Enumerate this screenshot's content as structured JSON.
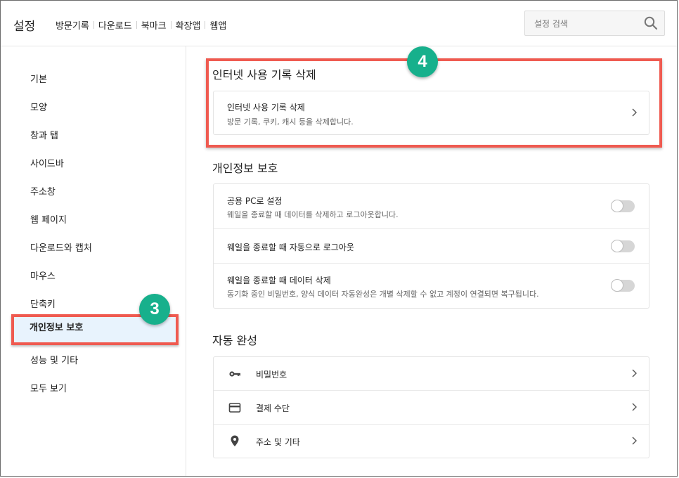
{
  "header": {
    "title": "설정",
    "nav": [
      "방문기록",
      "다운로드",
      "북마크",
      "확장앱",
      "웹앱"
    ],
    "search_placeholder": "설정 검색"
  },
  "sidebar": {
    "items": [
      {
        "label": "기본"
      },
      {
        "label": "모양"
      },
      {
        "label": "창과 탭"
      },
      {
        "label": "사이드바"
      },
      {
        "label": "주소창"
      },
      {
        "label": "웹 페이지"
      },
      {
        "label": "다운로드와 캡처"
      },
      {
        "label": "마우스"
      },
      {
        "label": "단축키"
      },
      {
        "label": "개인정보 보호",
        "active": true
      },
      {
        "label": "성능 및 기타"
      },
      {
        "label": "모두 보기"
      }
    ]
  },
  "annotations": {
    "sidebar_badge": "3",
    "content_badge": "4",
    "highlight_color": "#ef5a50",
    "badge_color": "#17b08c"
  },
  "sections": {
    "history": {
      "title": "인터넷 사용 기록 삭제",
      "item_title": "인터넷 사용 기록 삭제",
      "item_sub": "방문 기록, 쿠키, 캐시 등을 삭제합니다."
    },
    "privacy": {
      "title": "개인정보 보호",
      "rows": [
        {
          "title": "공용 PC로 설정",
          "sub": "웨일을 종료할 때 데이터를 삭제하고 로그아웃합니다.",
          "on": false
        },
        {
          "title": "웨일을 종료할 때 자동으로 로그아웃",
          "on": false
        },
        {
          "title": "웨일을 종료할 때 데이터 삭제",
          "sub": "동기화 중인 비밀번호, 양식 데이터 자동완성은 개별 삭제할 수 없고 계정이 연결되면 복구됩니다.",
          "on": false
        }
      ]
    },
    "autocomplete": {
      "title": "자동 완성",
      "rows": [
        {
          "label": "비밀번호",
          "icon": "key-icon"
        },
        {
          "label": "결제 수단",
          "icon": "card-icon"
        },
        {
          "label": "주소 및 기타",
          "icon": "location-pin-icon"
        }
      ]
    }
  }
}
